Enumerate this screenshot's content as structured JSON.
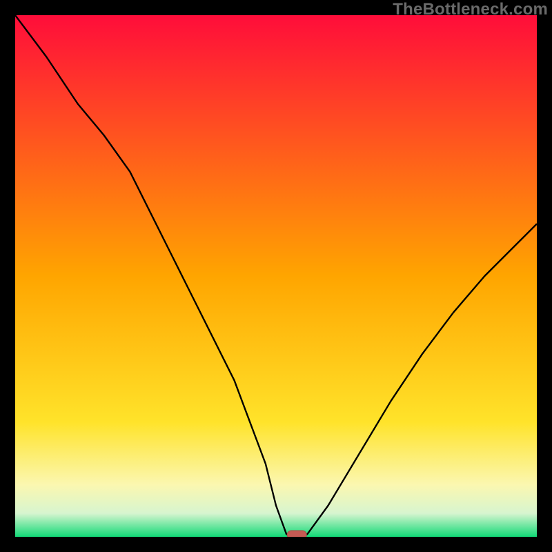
{
  "watermark": "TheBottleneck.com",
  "colors": {
    "frame": "#000000",
    "curve": "#000000",
    "marker_fill": "#c65a54",
    "marker_stroke": "#a84a45",
    "gradient_stops": [
      {
        "offset": 0.0,
        "color": "#ff0d3a"
      },
      {
        "offset": 0.5,
        "color": "#ffa500"
      },
      {
        "offset": 0.78,
        "color": "#ffe32a"
      },
      {
        "offset": 0.9,
        "color": "#fbf7b0"
      },
      {
        "offset": 0.955,
        "color": "#d7f5cf"
      },
      {
        "offset": 1.0,
        "color": "#12d977"
      }
    ]
  },
  "chart_data": {
    "type": "line",
    "title": "",
    "xlabel": "",
    "ylabel": "",
    "xlim": [
      0,
      100
    ],
    "ylim": [
      0,
      100
    ],
    "grid": false,
    "legend": false,
    "annotations": [],
    "marker": {
      "x": 54,
      "y": 0
    },
    "x": [
      0,
      6,
      12,
      17,
      22,
      26,
      30,
      34,
      38,
      42,
      45,
      48,
      50,
      52,
      54,
      56,
      60,
      66,
      72,
      78,
      84,
      90,
      96,
      100
    ],
    "values": [
      100,
      92,
      83,
      77,
      70,
      62,
      54,
      46,
      38,
      30,
      22,
      14,
      6,
      0.5,
      0,
      0.5,
      6,
      16,
      26,
      35,
      43,
      50,
      56,
      60
    ]
  }
}
